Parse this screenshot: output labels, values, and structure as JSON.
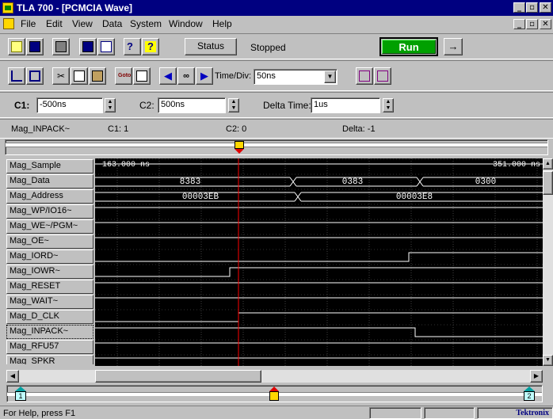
{
  "window": {
    "title": "TLA 700 - [PCMCIA Wave]"
  },
  "menu": [
    {
      "label": "File",
      "u": "F"
    },
    {
      "label": "Edit",
      "u": "E"
    },
    {
      "label": "View",
      "u": "V"
    },
    {
      "label": "Data",
      "u": "D"
    },
    {
      "label": "System",
      "u": "S"
    },
    {
      "label": "Window",
      "u": "W"
    },
    {
      "label": "Help",
      "u": "H"
    }
  ],
  "toolbar1": {
    "status_label": "Status",
    "status_value": "Stopped",
    "run_label": "Run",
    "arrow_glyph": "→"
  },
  "toolbar2": {
    "timediv_label": "Time/Div:",
    "timediv_value": "50ns"
  },
  "cursors": {
    "c1_label": "C1:",
    "c1_value": "-500ns",
    "c2_label": "C2:",
    "c2_value": "500ns",
    "delta_label": "Delta Time:",
    "delta_value": "1us"
  },
  "readout": {
    "signal": "Mag_INPACK~",
    "c1": "C1: 1",
    "c2": "C2: 0",
    "delta": "Delta: -1"
  },
  "timeline": {
    "left_time": "-163.000 ns",
    "right_time": "351.000 ns"
  },
  "signals": [
    "Mag_Sample",
    "Mag_Data",
    "Mag_Address",
    "Mag_WP/IO16~",
    "Mag_WE~/PGM~",
    "Mag_OE~",
    "Mag_IORD~",
    "Mag_IOWR~",
    "Mag_RESET",
    "Mag_WAIT~",
    "Mag_D_CLK",
    "Mag_INPACK~",
    "Mag_RFU57",
    "Mag_SPKR"
  ],
  "selected_signal": "Mag_INPACK~",
  "bus_values": {
    "data": [
      "8383",
      "0383",
      "0300"
    ],
    "address": [
      "00003EB",
      "00003E8"
    ]
  },
  "markers": {
    "c1": "1",
    "c2": "2"
  },
  "status": {
    "help": "For Help, press F1",
    "brand": "Tektronix"
  },
  "colors": {
    "titlebar": "#000080",
    "wave_bg": "#000000",
    "wave_line": "#ffffff",
    "cursor": "#ff0000",
    "run_button": "#00a000"
  }
}
